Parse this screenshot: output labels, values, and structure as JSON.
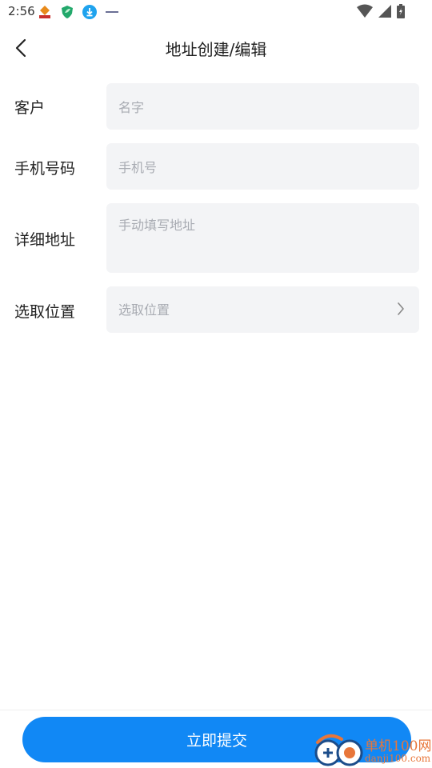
{
  "status_bar": {
    "time": "2:56",
    "notification_icons": [
      "app-logo-icon",
      "shield-leaf-icon",
      "download-icon",
      "small-logo-icon"
    ],
    "system_icons": [
      "wifi-icon",
      "signal-icon",
      "battery-icon"
    ]
  },
  "header": {
    "title": "地址创建/编辑"
  },
  "form": {
    "customer": {
      "label": "客户",
      "placeholder": "名字"
    },
    "phone": {
      "label": "手机号码",
      "placeholder": "手机号"
    },
    "address": {
      "label": "详细地址",
      "placeholder": "手动填写地址"
    },
    "location": {
      "label": "选取位置",
      "placeholder": "选取位置"
    }
  },
  "footer": {
    "submit_label": "立即提交"
  },
  "watermark": {
    "text": "单机100网",
    "sub": "danji100.com"
  },
  "colors": {
    "primary": "#1188f5",
    "field_bg": "#f3f4f6",
    "placeholder": "#a8abb2",
    "watermark": "#e8763a"
  }
}
